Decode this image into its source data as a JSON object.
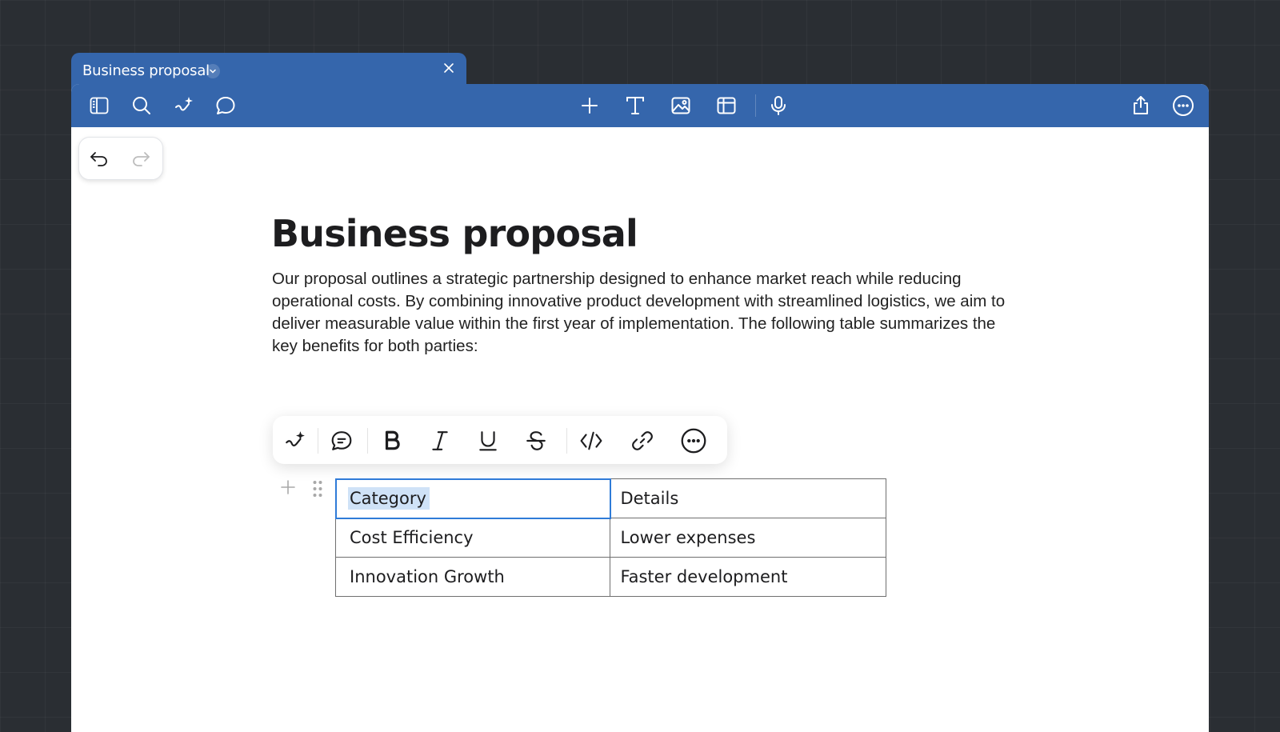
{
  "tab": {
    "title": "Business proposal"
  },
  "toolbar": {
    "left_icons": [
      "sidebar-icon",
      "search-icon",
      "ai-sparkle-icon",
      "comment-icon"
    ],
    "center_icons": [
      "plus-icon",
      "text-icon",
      "image-icon",
      "table-icon",
      "microphone-icon"
    ],
    "right_icons": [
      "share-icon",
      "more-icon"
    ]
  },
  "undo_controls": {
    "undo": "undo-icon",
    "redo": "redo-icon"
  },
  "document": {
    "title": "Business proposal",
    "body": "Our proposal outlines a strategic partnership designed to enhance market reach while reducing operational costs. By combining innovative product development with streamlined logistics, we aim to deliver measurable value within the first year of implementation. The following table summarizes the key benefits for both parties:"
  },
  "format_toolbar": {
    "icons": [
      "ai-sparkle-icon",
      "comment-icon",
      "bold-icon",
      "italic-icon",
      "underline-icon",
      "strikethrough-icon",
      "code-icon",
      "link-icon",
      "more-icon"
    ]
  },
  "table": {
    "rows": [
      [
        "Category",
        "Details"
      ],
      [
        "Cost Efficiency",
        "Lower expenses"
      ],
      [
        "Innovation Growth",
        "Faster development"
      ]
    ]
  },
  "colors": {
    "toolbar_blue": "#3566ac",
    "selection_outline": "#2f7bd8",
    "selection_highlight": "#cfe2f7",
    "background": "#2a2e33"
  }
}
